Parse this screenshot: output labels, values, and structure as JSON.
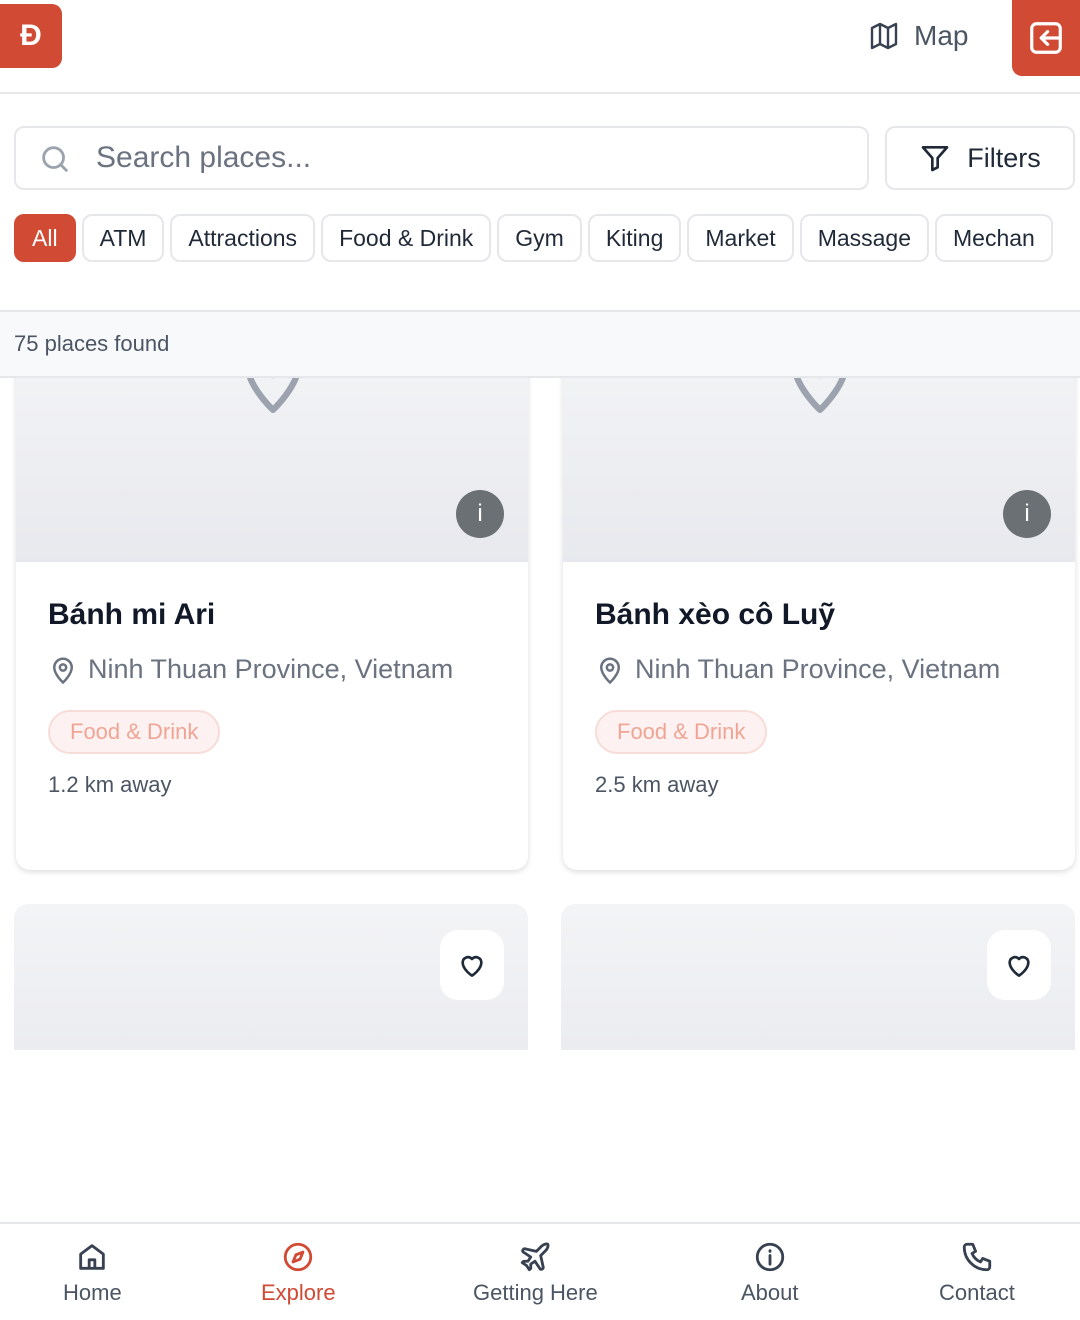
{
  "header": {
    "logo_text": "Đ",
    "map_label": "Map",
    "exit_icon": "log-in-icon"
  },
  "search": {
    "placeholder": "Search places...",
    "value": "",
    "filters_label": "Filters"
  },
  "categories": [
    {
      "label": "All",
      "active": true
    },
    {
      "label": "ATM"
    },
    {
      "label": "Attractions"
    },
    {
      "label": "Food & Drink"
    },
    {
      "label": "Gym"
    },
    {
      "label": "Kiting"
    },
    {
      "label": "Market"
    },
    {
      "label": "Massage"
    },
    {
      "label": "Mechan"
    }
  ],
  "results": {
    "count_text": "75 places found"
  },
  "places": [
    {
      "name": "Bánh mi Ari",
      "location": "Ninh Thuan Province, Vietnam",
      "category": "Food & Drink",
      "distance": "1.2 km away",
      "info": "i"
    },
    {
      "name": "Bánh xèo cô Luỹ",
      "location": "Ninh Thuan Province, Vietnam",
      "category": "Food & Drink",
      "distance": "2.5 km away",
      "info": "i"
    }
  ],
  "bottom_nav": [
    {
      "label": "Home",
      "icon": "home-icon"
    },
    {
      "label": "Explore",
      "icon": "compass-icon",
      "active": true
    },
    {
      "label": "Getting Here",
      "icon": "plane-icon"
    },
    {
      "label": "About",
      "icon": "info-icon"
    },
    {
      "label": "Contact",
      "icon": "phone-icon"
    }
  ],
  "colors": {
    "accent": "#d04a34",
    "tag_text": "#f0a494",
    "tag_bg": "#fdf2f1",
    "muted_text": "#6b7280"
  }
}
